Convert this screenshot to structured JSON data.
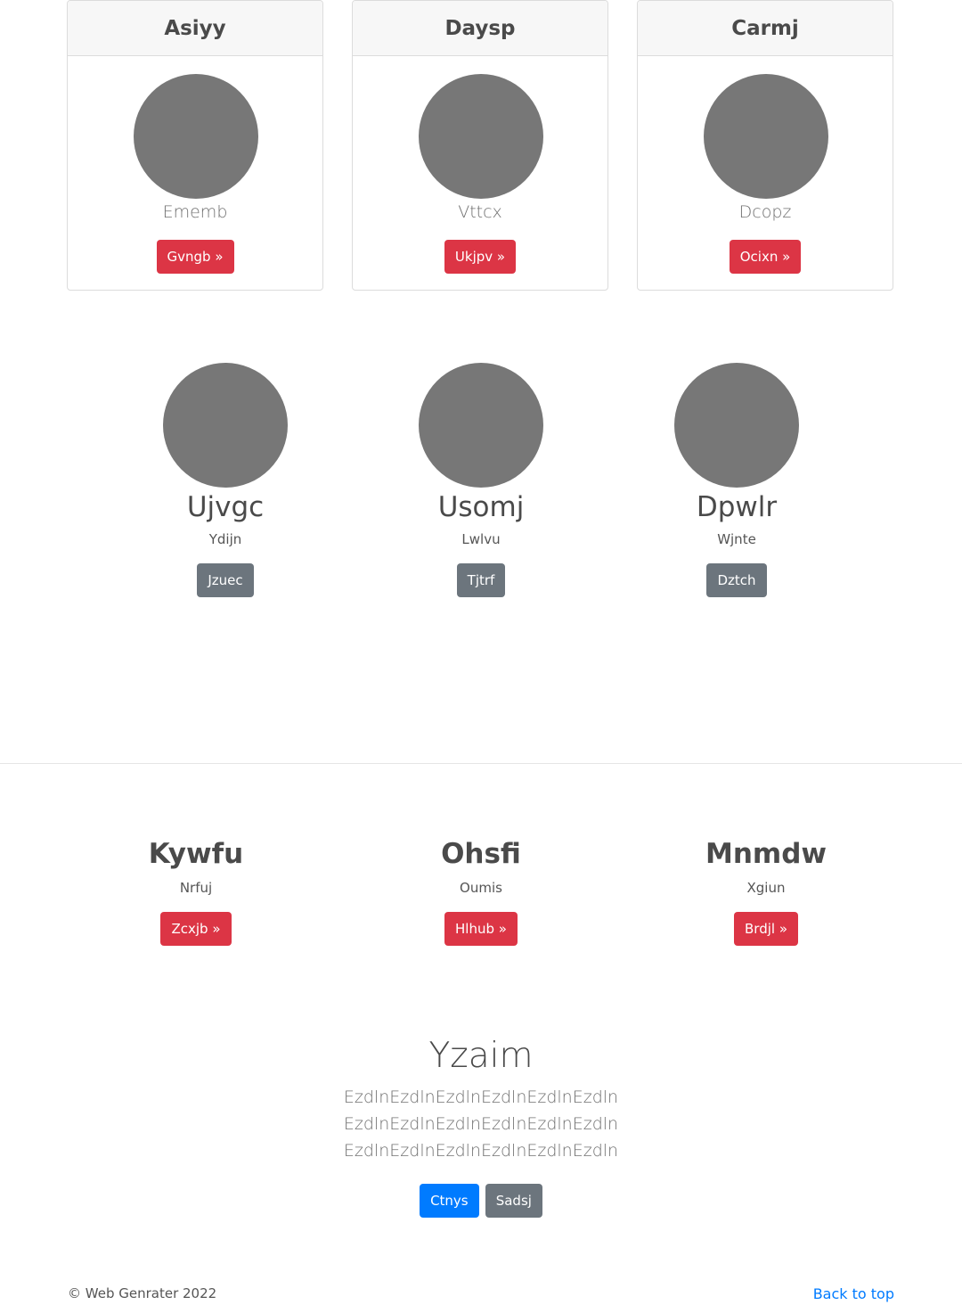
{
  "cards": [
    {
      "title": "Asiyy",
      "subtitle": "Ememb",
      "button": "Gvngb »"
    },
    {
      "title": "Daysp",
      "subtitle": "Vttcx",
      "button": "Ukjpv »"
    },
    {
      "title": "Carmj",
      "subtitle": "Dcopz",
      "button": "Ocixn »"
    }
  ],
  "profiles": [
    {
      "name": "Ujvgc",
      "subtitle": "Ydijn",
      "button": "Jzuec"
    },
    {
      "name": "Usomj",
      "subtitle": "Lwlvu",
      "button": "Tjtrf"
    },
    {
      "name": "Dpwlr",
      "subtitle": "Wjnte",
      "button": "Dztch"
    }
  ],
  "features": [
    {
      "title": "Kywfu",
      "subtitle": "Nrfuj",
      "button": "Zcxjb »"
    },
    {
      "title": "Ohsfi",
      "subtitle": "Oumis",
      "button": "Hlhub »"
    },
    {
      "title": "Mnmdw",
      "subtitle": "Xgiun",
      "button": "Brdjl »"
    }
  ],
  "hero": {
    "title": "Yzaim",
    "text": "EzdlnEzdlnEzdlnEzdlnEzdlnEzdln EzdlnEzdlnEzdlnEzdlnEzdlnEzdln EzdlnEzdlnEzdlnEzdlnEzdlnEzdln",
    "primary_button": "Ctnys",
    "secondary_button": "Sadsj"
  },
  "footer": {
    "copyright": "© Web Genrater 2022",
    "back_to_top": "Back to top"
  },
  "colors": {
    "danger": "#dc3545",
    "secondary": "#6c757d",
    "primary": "#007bff",
    "avatar": "#777777"
  }
}
